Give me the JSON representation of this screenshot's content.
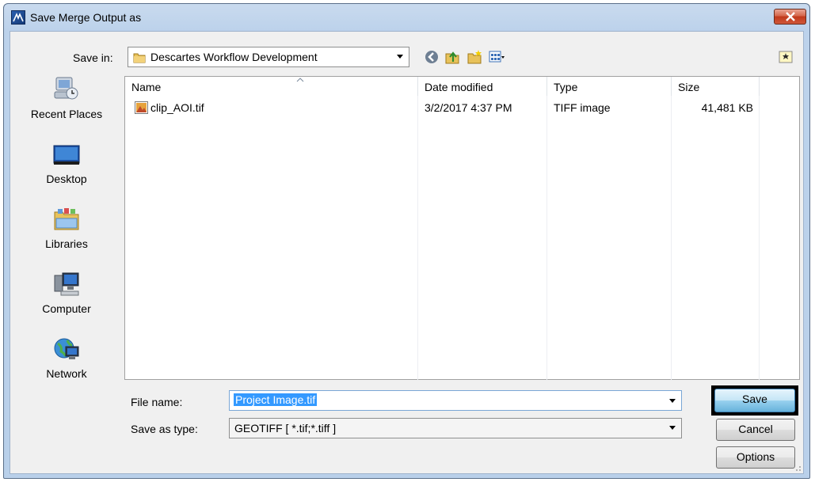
{
  "window": {
    "title": "Save Merge Output as"
  },
  "toolbar": {
    "save_in_label": "Save in:",
    "save_in_value": "Descartes Workflow Development"
  },
  "places": [
    {
      "label": "Recent Places",
      "icon": "recent-places-icon"
    },
    {
      "label": "Desktop",
      "icon": "desktop-icon"
    },
    {
      "label": "Libraries",
      "icon": "libraries-icon"
    },
    {
      "label": "Computer",
      "icon": "computer-icon"
    },
    {
      "label": "Network",
      "icon": "network-icon"
    }
  ],
  "columns": {
    "name": "Name",
    "date": "Date modified",
    "type": "Type",
    "size": "Size"
  },
  "files": [
    {
      "name": "clip_AOI.tif",
      "date": "3/2/2017 4:37 PM",
      "type": "TIFF image",
      "size": "41,481 KB"
    }
  ],
  "form": {
    "file_name_label": "File name:",
    "file_name_value": "Project Image.tif",
    "type_label": "Save as type:",
    "type_value": "GEOTIFF [ *.tif;*.tiff ]"
  },
  "buttons": {
    "save": "Save",
    "cancel": "Cancel",
    "options": "Options"
  },
  "colors": {
    "titlebar": "#bcd2eb",
    "selection": "#3399ff",
    "save_highlight_border": "#000000",
    "close_button": "#c0391b"
  }
}
